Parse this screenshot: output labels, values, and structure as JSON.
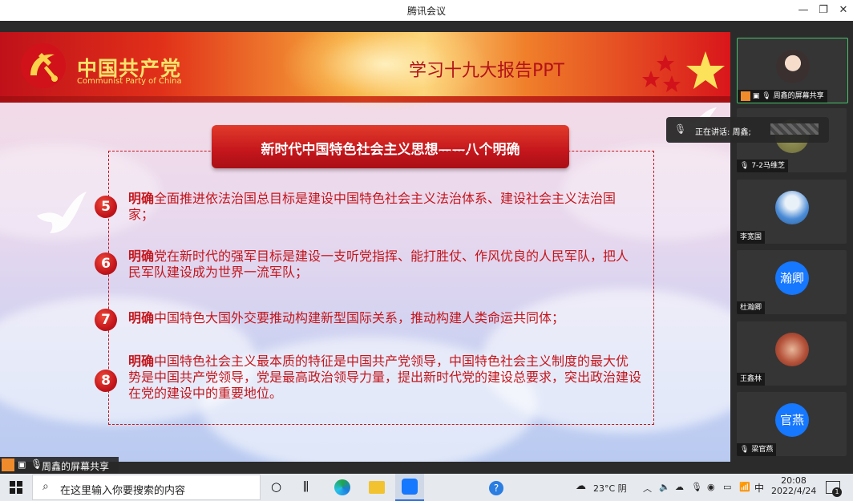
{
  "window": {
    "title": "腾讯会议"
  },
  "slide": {
    "party_cn": "中国共产党",
    "party_en": "Communist Party of China",
    "title": "学习十九大报告PPT",
    "heading": "新时代中国特色社会主义思想——八个明确",
    "items": [
      {
        "num": "5",
        "lead": "明确",
        "text": "全面推进依法治国总目标是建设中国特色社会主义法治体系、建设社会主义法治国家；"
      },
      {
        "num": "6",
        "lead": "明确",
        "text": "党在新时代的强军目标是建设一支听党指挥、能打胜仗、作风优良的人民军队，把人民军队建设成为世界一流军队；"
      },
      {
        "num": "7",
        "lead": "明确",
        "text": "中国特色大国外交要推动构建新型国际关系，推动构建人类命运共同体；"
      },
      {
        "num": "8",
        "lead": "明确",
        "text": "中国特色社会主义最本质的特征是中国共产党领导，中国特色社会主义制度的最大优势是中国共产党领导，党是最高政治领导力量，提出新时代党的建设总要求，突出政治建设在党的建设中的重要地位。"
      }
    ]
  },
  "presenter": {
    "label": "周鑫的屏幕共享"
  },
  "speaking": {
    "label": "正在讲话: 周鑫;"
  },
  "participants": [
    {
      "name": "周鑫的屏幕共享",
      "avatar_text": ""
    },
    {
      "name": "7-2马维芝",
      "avatar_text": ""
    },
    {
      "name": "李宽国",
      "avatar_text": ""
    },
    {
      "name": "杜瀚卿",
      "avatar_text": "瀚卿"
    },
    {
      "name": "王鑫林",
      "avatar_text": ""
    },
    {
      "name": "梁官燕",
      "avatar_text": "官燕"
    }
  ],
  "taskbar": {
    "search_placeholder": "在这里输入你要搜索的内容",
    "weather": "23°C 阴",
    "ime": "中",
    "time": "20:08",
    "date": "2022/4/24",
    "notif_count": "1"
  }
}
